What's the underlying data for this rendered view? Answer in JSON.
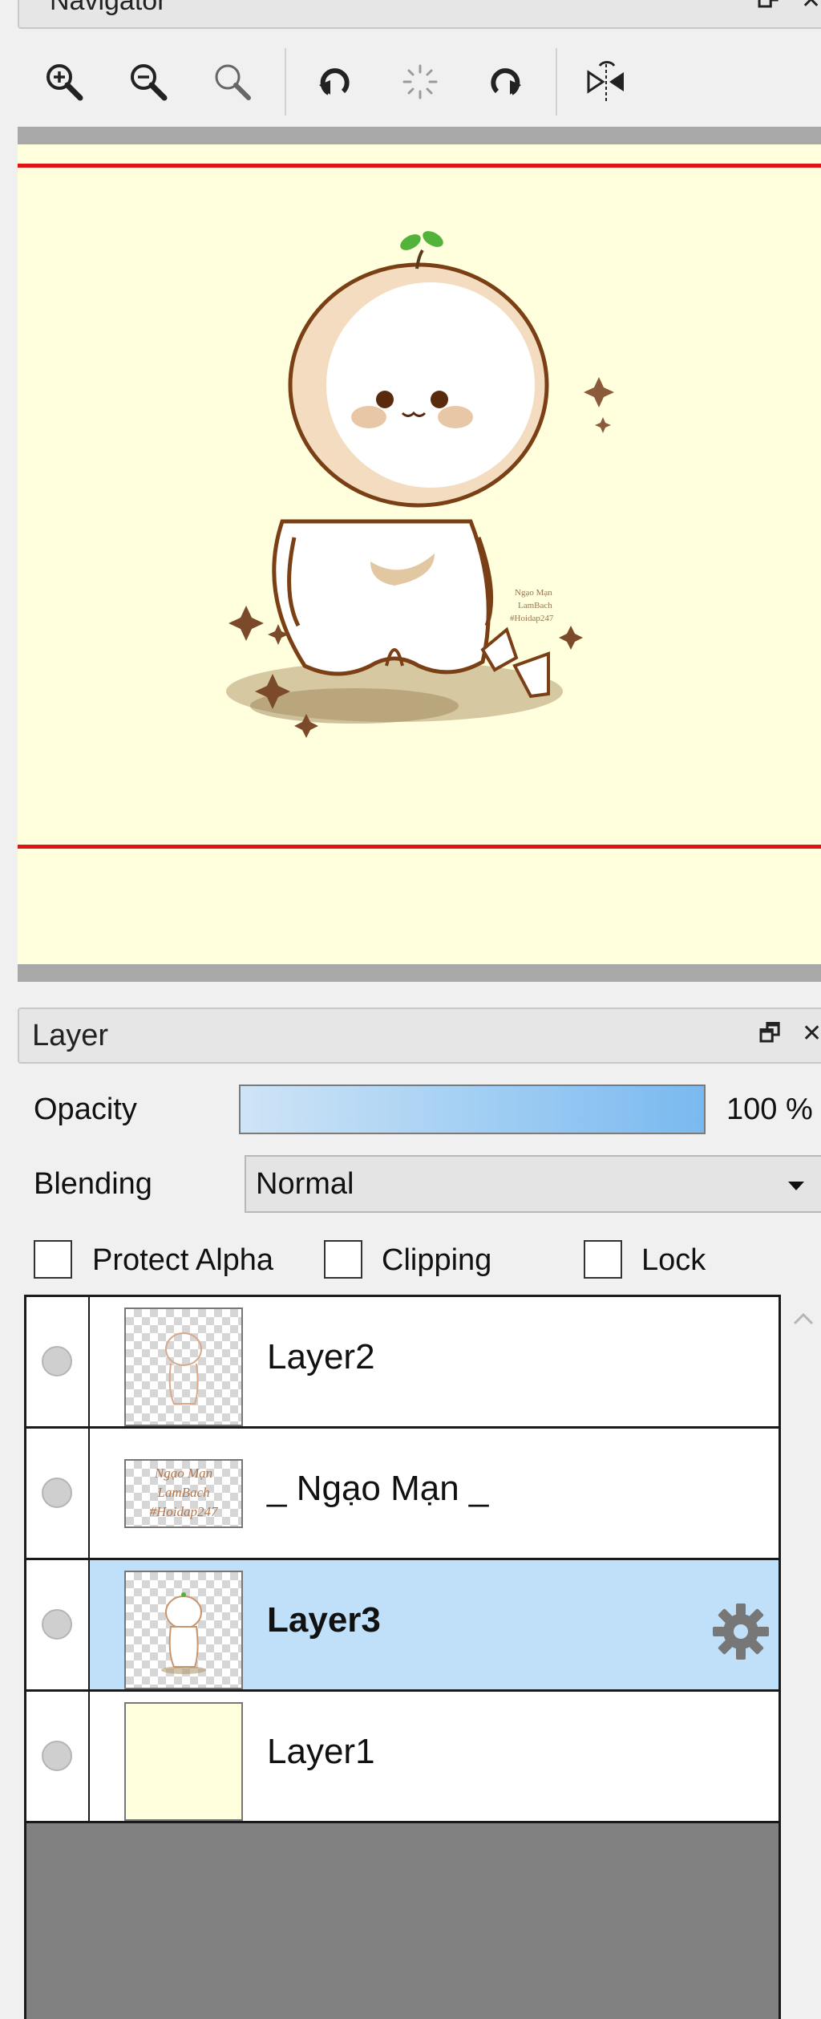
{
  "navigator": {
    "title": "Navigator",
    "toolbar": {
      "buttons": [
        {
          "name": "zoom-in-button",
          "icon": "zoom-in-icon"
        },
        {
          "name": "zoom-out-button",
          "icon": "zoom-out-icon"
        },
        {
          "name": "zoom-reset-button",
          "icon": "zoom-reset-icon"
        },
        {
          "name": "rotate-left-button",
          "icon": "rotate-left-icon"
        },
        {
          "name": "rotate-reset-button",
          "icon": "rotate-reset-icon"
        },
        {
          "name": "rotate-right-button",
          "icon": "rotate-right-icon"
        },
        {
          "name": "flip-horizontal-button",
          "icon": "flip-horizontal-icon"
        }
      ]
    },
    "canvas": {
      "background": "#ffffdd",
      "frame_line_color": "#e01414",
      "signature_lines": [
        "Ngạo Mạn",
        "LamBach",
        "#Hoidap247"
      ]
    }
  },
  "layer_panel": {
    "title": "Layer",
    "opacity": {
      "label": "Opacity",
      "value_text": "100 %",
      "value": 1.0
    },
    "blending": {
      "label": "Blending",
      "value": "Normal"
    },
    "checkboxes": [
      {
        "label": "Protect Alpha",
        "checked": false
      },
      {
        "label": "Clipping",
        "checked": false
      },
      {
        "label": "Lock",
        "checked": false
      }
    ],
    "layers": [
      {
        "name": "Layer2",
        "selected": false
      },
      {
        "name": "_ Ngạo Mạn _",
        "selected": false,
        "thumb_text": [
          "Ngạo Mạn",
          "LamBach",
          "#Hoidap247"
        ]
      },
      {
        "name": "Layer3",
        "selected": true
      },
      {
        "name": "Layer1",
        "selected": false,
        "thumb_color": "#ffffdd"
      }
    ],
    "selected_color": "#bfe0f8",
    "accent": "#7ab9f0"
  }
}
